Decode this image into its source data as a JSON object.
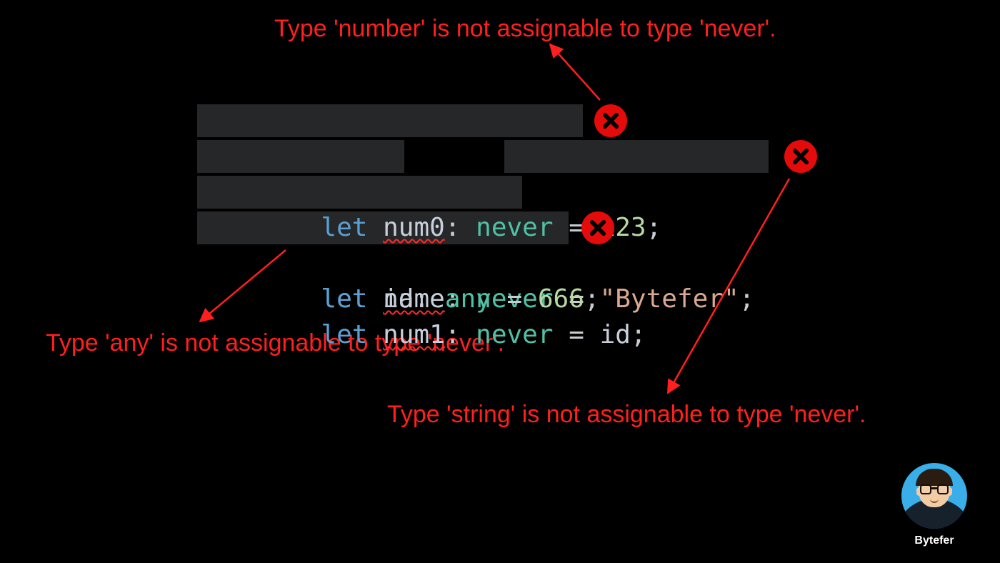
{
  "annotations": {
    "top": "Type 'number' is not assignable to type 'never'.",
    "left": "Type 'any' is not assignable to type 'never'.",
    "bottom": "Type 'string' is not assignable to type 'never'."
  },
  "code": {
    "line1": {
      "kw": "let ",
      "var": "num0",
      "colon": ": ",
      "type": "never",
      "eq": " = ",
      "val": "123",
      "semi": ";"
    },
    "line2": {
      "kw": "let ",
      "var": "name",
      "colon": ": ",
      "type": "never",
      "eq": " = ",
      "val": "\"Bytefer\"",
      "semi": ";"
    },
    "line3": {
      "kw": "let ",
      "var": "id",
      "colon": ": ",
      "type": "any",
      "eq": " = ",
      "val": "666",
      "semi": ";"
    },
    "line4": {
      "kw": "let ",
      "var": "num1",
      "colon": ": ",
      "type": "never",
      "eq": " = ",
      "val": "id",
      "semi": ";"
    }
  },
  "author": "Bytefer",
  "colors": {
    "annotation": "#ff1f1f",
    "errorBadge": "#e40b0b",
    "codeBg": "#262728"
  }
}
